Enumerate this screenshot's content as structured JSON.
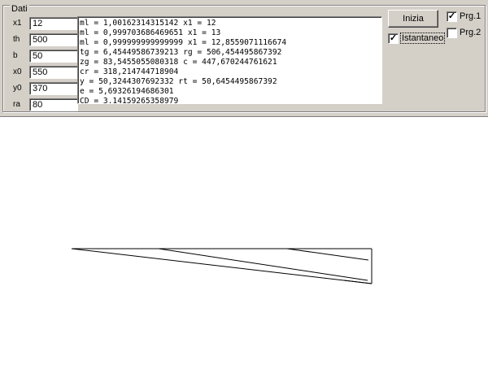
{
  "group": {
    "title": "Dati"
  },
  "params": [
    {
      "label": "x1",
      "value": "12"
    },
    {
      "label": "th",
      "value": "500"
    },
    {
      "label": "b",
      "value": "50"
    },
    {
      "label": "x0",
      "value": "550"
    },
    {
      "label": "y0",
      "value": "370"
    },
    {
      "label": "ra",
      "value": "80"
    }
  ],
  "output": [
    "ml = 1,00162314315142 x1 = 12",
    "ml = 0,999703686469651 x1 = 13",
    "ml = 0,999999999999999 x1 = 12,8559071116674",
    "tg = 6,45449586739213 rg = 506,454495867392",
    "zg = 83,5455055080318 c = 447,670244761621",
    "cr = 318,214744718904",
    "y = 50,3244307692332 rt = 50,6454495867392",
    "e = 5,69326194686301",
    "CD = 3,14159265358979"
  ],
  "controls": {
    "start_label": "Inizia",
    "istantaneo_label": "Istantaneo",
    "istantaneo_checked": true,
    "prg1_label": "Prg.1",
    "prg1_checked": true,
    "prg2_label": "Prg.2",
    "prg2_checked": false
  },
  "colors": {
    "panel": "#d4d0c8",
    "canvas": "#ffffff",
    "line": "#000000"
  }
}
